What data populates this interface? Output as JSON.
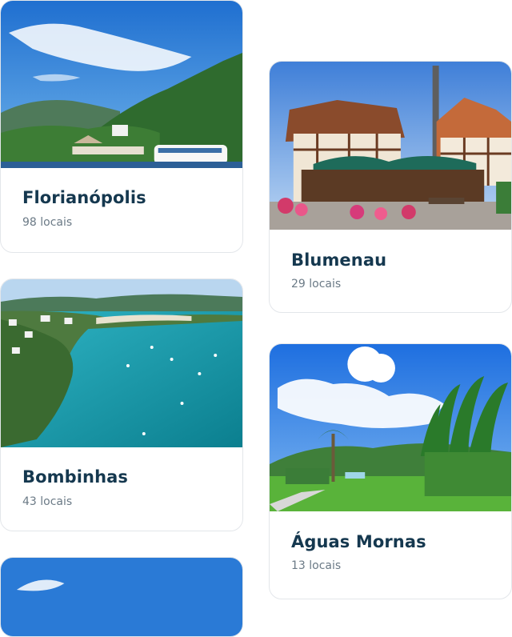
{
  "destinations": [
    {
      "name": "Florianópolis",
      "count": "98 locais"
    },
    {
      "name": "Blumenau",
      "count": "29 locais"
    },
    {
      "name": "Bombinhas",
      "count": "43 locais"
    },
    {
      "name": "Águas Mornas",
      "count": "13 locais"
    }
  ],
  "colors": {
    "title": "#15384f",
    "subtitle": "#6b7a86",
    "card_border": "#e3e6ea"
  }
}
